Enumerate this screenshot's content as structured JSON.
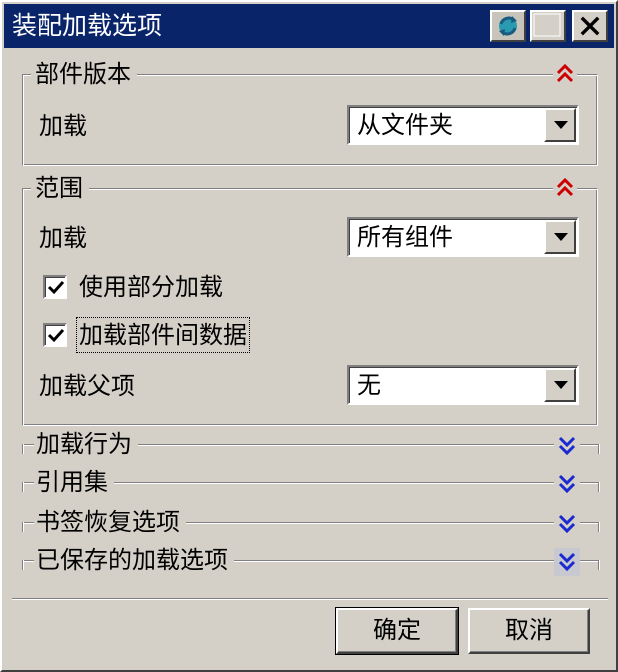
{
  "window": {
    "title": "装配加载选项"
  },
  "sections": {
    "part_version": {
      "legend": "部件版本",
      "load_label": "加载",
      "load_value": "从文件夹"
    },
    "scope": {
      "legend": "范围",
      "load_label": "加载",
      "load_value": "所有组件",
      "use_partial_load": {
        "label": "使用部分加载",
        "checked": true
      },
      "load_interpart_data": {
        "label": "加载部件间数据",
        "checked": true
      },
      "load_parent_label": "加载父项",
      "load_parent_value": "无"
    },
    "collapsed": [
      {
        "label": "加载行为"
      },
      {
        "label": "引用集"
      },
      {
        "label": "书签恢复选项"
      },
      {
        "label": "已保存的加载选项"
      }
    ]
  },
  "buttons": {
    "ok": "确定",
    "cancel": "取消"
  },
  "colors": {
    "title_bar": "#0a246a",
    "face": "#d4d0c8",
    "collapse_arrow": "#cc0000",
    "expand_arrow": "#1a2ad0"
  },
  "icons": {
    "title_refresh": "refresh-icon",
    "title_restore": "restore-icon",
    "title_close": "close-icon",
    "collapse": "double-chevron-up-icon",
    "expand": "double-chevron-down-icon",
    "dropdown": "dropdown-arrow-icon",
    "check": "checkmark-icon"
  }
}
